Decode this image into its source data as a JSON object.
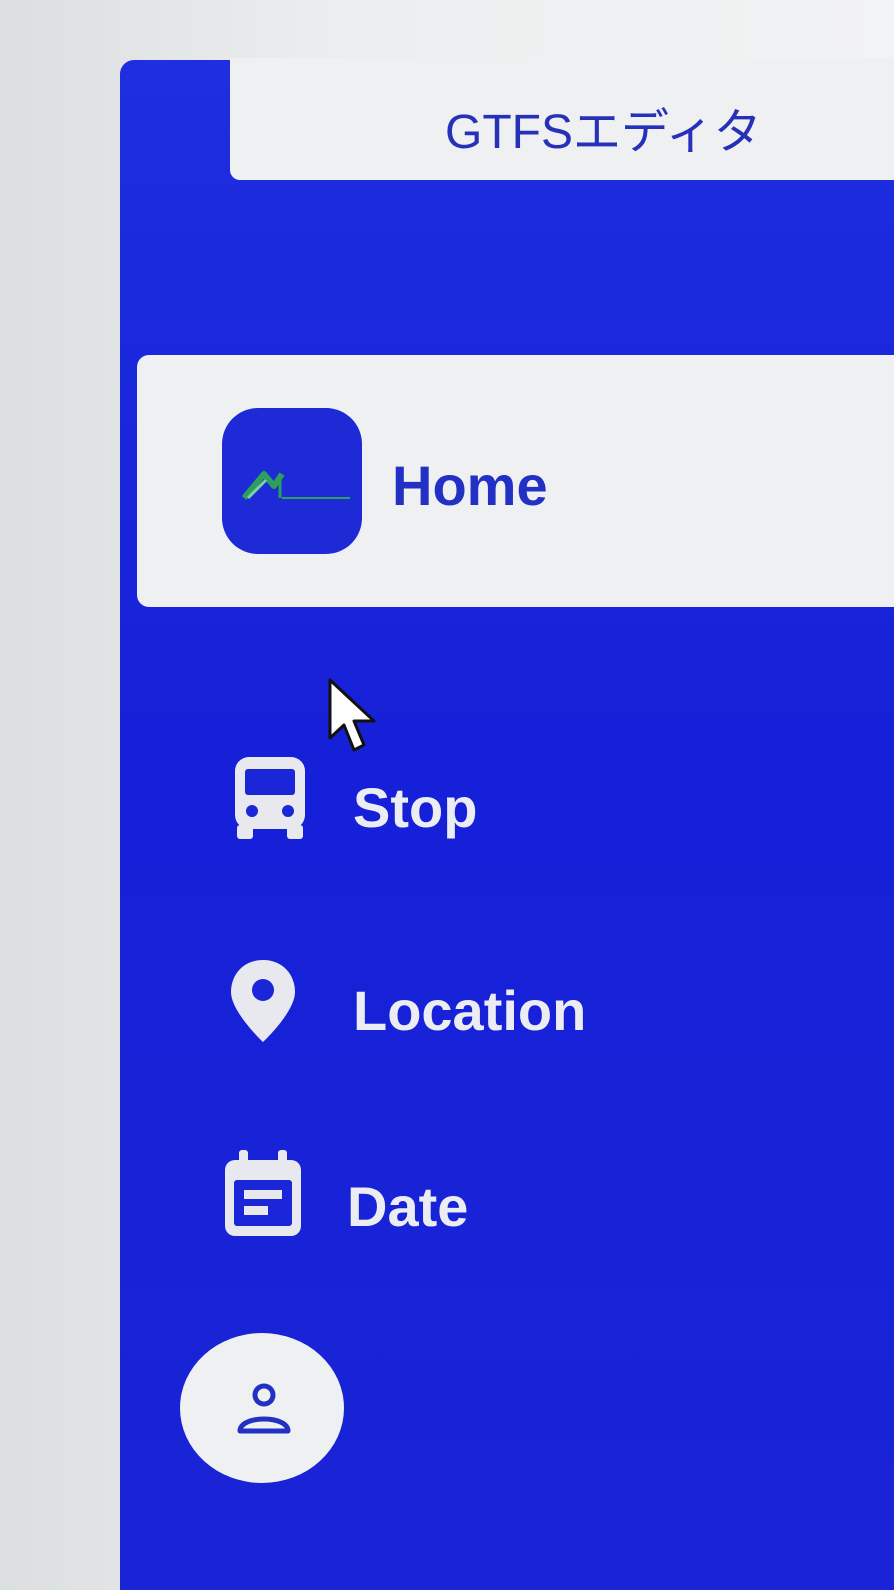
{
  "app": {
    "title": "GTFSエディタ"
  },
  "nav": {
    "home": {
      "label": "Home",
      "icon": "app-logo-icon"
    },
    "items": [
      {
        "label": "Stop",
        "icon": "bus-icon"
      },
      {
        "label": "Location",
        "icon": "location-pin-icon"
      },
      {
        "label": "Date",
        "icon": "calendar-icon"
      }
    ],
    "account": {
      "icon": "user-icon"
    }
  },
  "colors": {
    "sidebar": "#1a24d6",
    "active_item_bg": "#eff0f2",
    "active_text": "#2330c4",
    "nav_text": "#ecedf2",
    "logo_green": "#2aa05a"
  }
}
